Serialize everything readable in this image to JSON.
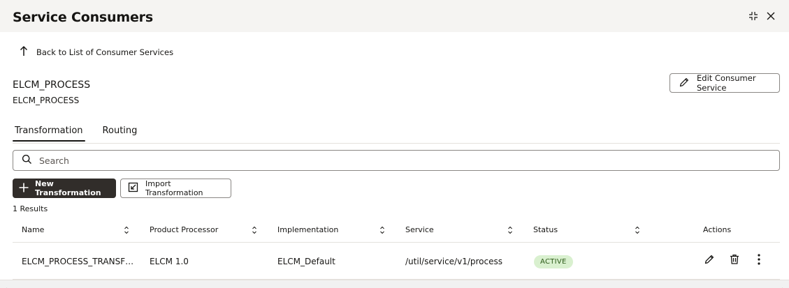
{
  "header": {
    "title": "Service Consumers",
    "minimize_icon": "collapse-icon",
    "close_icon": "close-icon"
  },
  "back": {
    "label": "Back to List of Consumer Services",
    "icon": "arrow-up-icon"
  },
  "consumer": {
    "name": "ELCM_PROCESS",
    "subtitle": "ELCM_PROCESS"
  },
  "edit_button": {
    "label": "Edit Consumer Service",
    "icon": "pencil-icon"
  },
  "tabs": [
    {
      "label": "Transformation",
      "active": true
    },
    {
      "label": "Routing",
      "active": false
    }
  ],
  "search": {
    "placeholder": "Search",
    "value": "",
    "icon": "search-icon"
  },
  "toolbar": {
    "new_label": "New Transformation",
    "new_icon": "plus-icon",
    "import_label": "Import Transformation",
    "import_icon": "import-icon"
  },
  "results_text": "1 Results",
  "table": {
    "columns": [
      "Name",
      "Product Processor",
      "Implementation",
      "Service",
      "Status",
      "Actions"
    ],
    "rows": [
      {
        "name": "ELCM_PROCESS_TRANSF…",
        "product_processor": "ELCM 1.0",
        "implementation": "ELCM_Default",
        "service": "/util/service/v1/process",
        "status": "ACTIVE"
      }
    ]
  },
  "colors": {
    "header_bg": "#f5f4f2",
    "primary_button": "#312d2a",
    "status_active_bg": "#d9f0cf",
    "status_active_text": "#2c5a18"
  }
}
